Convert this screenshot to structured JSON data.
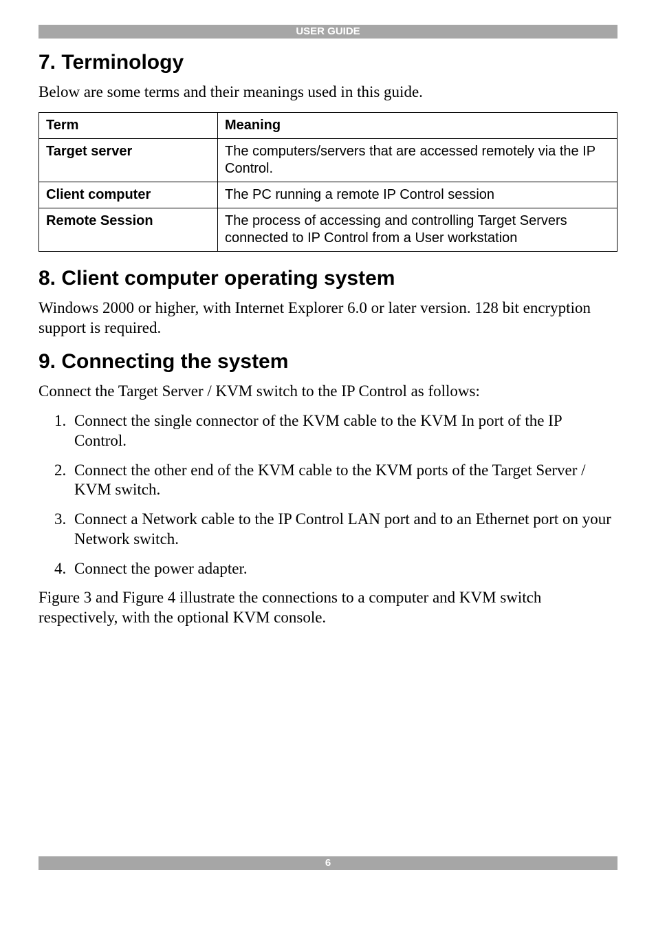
{
  "header_banner": "USER GUIDE",
  "footer_page_number": "6",
  "section7": {
    "heading": "7. Terminology",
    "intro": "Below are some terms and their meanings used in this guide.",
    "table": {
      "head_term": "Term",
      "head_meaning": "Meaning",
      "rows": [
        {
          "term": "Target server",
          "meaning": "The computers/servers that are accessed remotely via the IP Control."
        },
        {
          "term": "Client computer",
          "meaning": "The PC running a remote IP Control session"
        },
        {
          "term": "Remote Session",
          "meaning": "The process of accessing and controlling Target Servers connected to IP Control from a User workstation"
        }
      ]
    }
  },
  "section8": {
    "heading": "8. Client computer operating system",
    "body": "Windows 2000 or higher, with Internet Explorer 6.0 or later version. 128 bit encryption support is required."
  },
  "section9": {
    "heading": "9. Connecting the system",
    "intro": "Connect the Target Server / KVM switch to the IP Control as follows:",
    "steps": [
      "Connect the single connector of the KVM cable to the KVM In port of the IP Control.",
      "Connect the other end of the KVM cable to the KVM ports of the Target Server / KVM switch.",
      "Connect a Network cable to the IP Control LAN port and to an Ethernet port on your Network switch.",
      "Connect the power adapter."
    ],
    "outro": "Figure 3 and Figure 4 illustrate the connections to a computer and KVM switch respectively, with the optional KVM console."
  }
}
